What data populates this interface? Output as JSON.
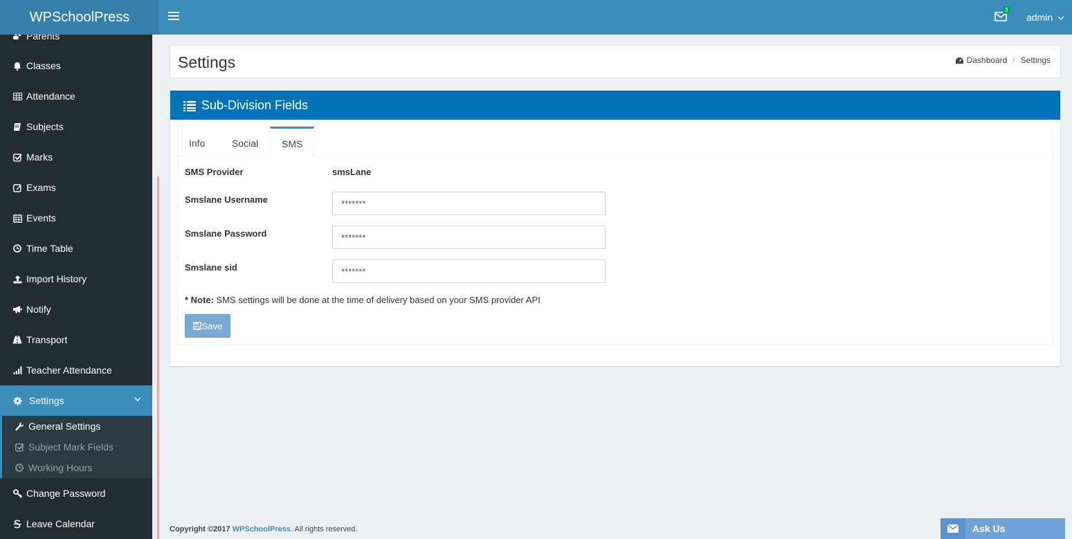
{
  "header": {
    "logo": "WPSchoolPress",
    "mail_count": "3",
    "user": "admin"
  },
  "sidebar": {
    "items": [
      {
        "label": "Parents",
        "icon": "parents-icon"
      },
      {
        "label": "Classes",
        "icon": "bell-icon"
      },
      {
        "label": "Attendance",
        "icon": "table-icon"
      },
      {
        "label": "Subjects",
        "icon": "book-icon"
      },
      {
        "label": "Marks",
        "icon": "check-square-icon"
      },
      {
        "label": "Exams",
        "icon": "edit-icon"
      },
      {
        "label": "Events",
        "icon": "calendar-icon"
      },
      {
        "label": "Time Table",
        "icon": "clock-icon"
      },
      {
        "label": "Import History",
        "icon": "upload-icon"
      },
      {
        "label": "Notify",
        "icon": "bullhorn-icon"
      },
      {
        "label": "Transport",
        "icon": "road-icon"
      },
      {
        "label": "Teacher Attendance",
        "icon": "signal-icon"
      },
      {
        "label": "Settings",
        "icon": "gear-icon"
      }
    ],
    "submenu": [
      {
        "label": "General Settings",
        "icon": "wrench-icon"
      },
      {
        "label": "Subject Mark Fields",
        "icon": "check-square-icon"
      },
      {
        "label": "Working Hours",
        "icon": "clock-icon"
      }
    ],
    "after": [
      {
        "label": "Change Password",
        "icon": "key-icon"
      },
      {
        "label": "Leave Calendar",
        "icon": "strikethrough-icon"
      }
    ]
  },
  "page": {
    "title": "Settings",
    "breadcrumb": [
      "Dashboard",
      "Settings"
    ]
  },
  "box": {
    "title": "Sub-Division Fields",
    "tabs": [
      "Info",
      "Social",
      "SMS"
    ],
    "active_tab": "SMS",
    "sms_provider_label": "SMS Provider",
    "sms_provider_value": "smsLane",
    "fields": [
      {
        "label": "Smslane Username",
        "value": "*******"
      },
      {
        "label": "Smslane Password",
        "value": "*******"
      },
      {
        "label": "Smslane sid",
        "value": "*******"
      }
    ],
    "note_prefix": "* Note:",
    "note_text": " SMS settings will be done at the time of delivery based on your SMS provider API",
    "save_label": "Save"
  },
  "footer": {
    "prefix": "Copyright ©2017 ",
    "brand": "WPSchoolPress",
    "suffix": ". All rights reserved."
  },
  "askus": "Ask Us",
  "colors": {
    "header": "#3c8dbc",
    "logo_bg": "#367fa9",
    "sidebar": "#222d32",
    "box_header": "#0073b7",
    "accent": "#3c8dbc"
  }
}
